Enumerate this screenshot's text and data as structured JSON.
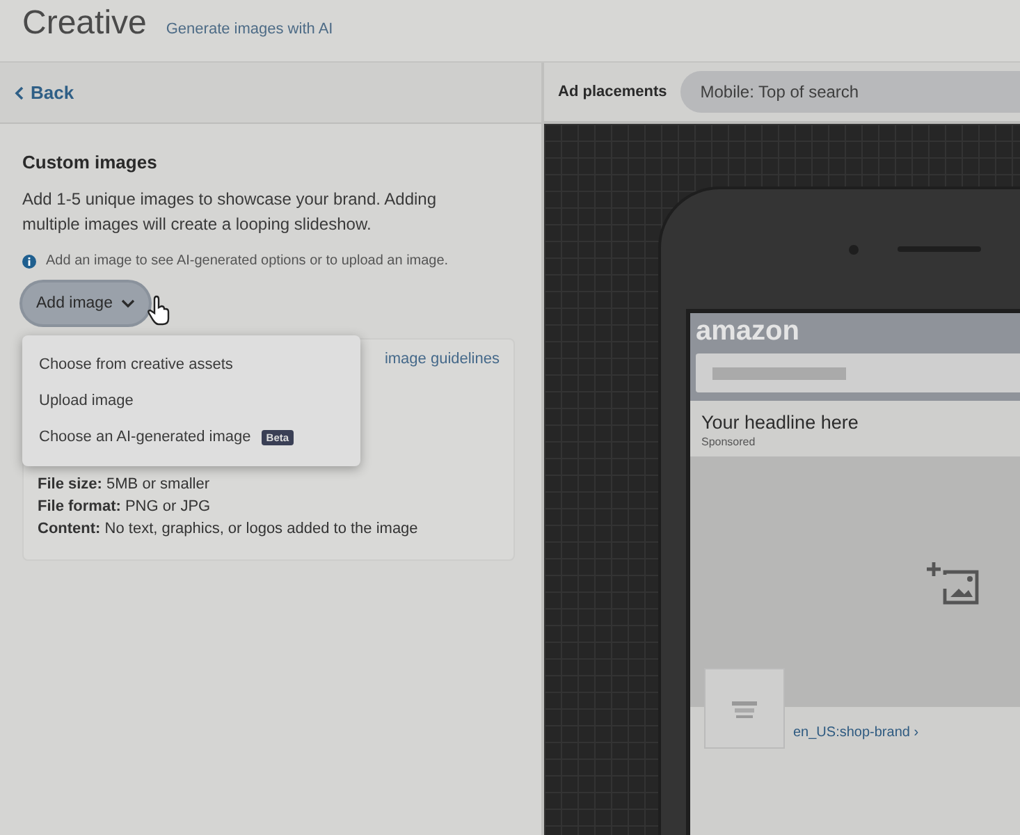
{
  "header": {
    "title": "Creative",
    "link": "Generate images with AI"
  },
  "back": {
    "label": "Back"
  },
  "section": {
    "title": "Custom images",
    "description": "Add 1-5 unique images to showcase your brand. Adding multiple images will create a looping slideshow.",
    "info": "Add an image to see AI-generated options or to upload an image."
  },
  "add_button": {
    "label": "Add image",
    "expanded": true
  },
  "menu": [
    {
      "label": "Choose from creative assets"
    },
    {
      "label": "Upload image"
    },
    {
      "label": "Choose an AI-generated image",
      "badge": "Beta"
    }
  ],
  "guidelines": {
    "link": "image guidelines",
    "lines": [
      "**File size:** 5MB or smaller",
      "**File format:** PNG or JPG",
      "**Content:** No text, graphics, or logos added to the image"
    ]
  },
  "preview": {
    "label": "Ad placements",
    "placement": "Mobile: Top of search",
    "logo": "amazon",
    "headline": "Your headline here",
    "sponsored": "Sponsored",
    "store_link": "en_US:shop-brand ›"
  }
}
